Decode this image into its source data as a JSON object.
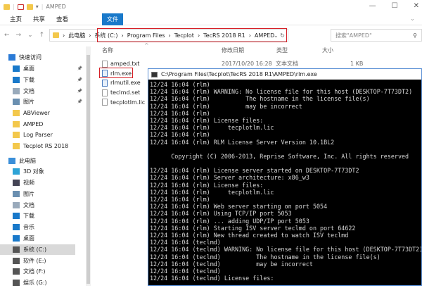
{
  "window": {
    "title": "AMPED"
  },
  "ribbon": {
    "tabs": [
      "文件",
      "主页",
      "共享",
      "查看"
    ]
  },
  "address": {
    "crumbs": [
      "此电脑",
      "系统 (C:)",
      "Program Files",
      "Tecplot",
      "TecRS 2018 R1",
      "AMPED"
    ],
    "search_placeholder": "搜索\"AMPED\""
  },
  "columns": {
    "name": "名称",
    "date": "修改日期",
    "type": "类型",
    "size": "大小"
  },
  "files": [
    {
      "name": "amped.txt",
      "date": "2017/10/20 16:28",
      "type": "文本文档",
      "size": "1 KB",
      "kind": "txt"
    },
    {
      "name": "rlm.exe",
      "kind": "exe"
    },
    {
      "name": "rlmutil.exe",
      "kind": "exe"
    },
    {
      "name": "teclmd.set",
      "kind": "txt"
    },
    {
      "name": "tecplotlm.lic",
      "kind": "txt"
    }
  ],
  "sidebar": {
    "items": [
      {
        "label": "快速访问",
        "color": "#2a7ad6",
        "indent": 0
      },
      {
        "label": "桌面",
        "color": "#1979ca",
        "pin": true
      },
      {
        "label": "下载",
        "color": "#1979ca",
        "pin": true
      },
      {
        "label": "文档",
        "color": "#9ab",
        "pin": true
      },
      {
        "label": "图片",
        "color": "#6a8fb0",
        "pin": true
      },
      {
        "label": "ABViewer",
        "color": "#f3c84c"
      },
      {
        "label": "AMPED",
        "color": "#f3c84c"
      },
      {
        "label": "Log Parser",
        "color": "#f3c84c"
      },
      {
        "label": "Tecplot RS 2018",
        "color": "#f3c84c"
      },
      {
        "label": "此电脑",
        "color": "#3b8fd9",
        "indent": 0
      },
      {
        "label": "3D 对象",
        "color": "#2ea3d6"
      },
      {
        "label": "视频",
        "color": "#445"
      },
      {
        "label": "图片",
        "color": "#6a8fb0"
      },
      {
        "label": "文档",
        "color": "#9ab"
      },
      {
        "label": "下载",
        "color": "#1979ca"
      },
      {
        "label": "音乐",
        "color": "#1979ca"
      },
      {
        "label": "桌面",
        "color": "#1979ca"
      },
      {
        "label": "系统 (C:)",
        "color": "#555",
        "selected": true
      },
      {
        "label": "软件 (E:)",
        "color": "#555"
      },
      {
        "label": "文档 (F:)",
        "color": "#555"
      },
      {
        "label": "娱乐 (G:)",
        "color": "#555"
      }
    ]
  },
  "console": {
    "title": "C:\\Program Files\\Tecplot\\TecRS 2018 R1\\AMPED\\rlm.exe",
    "lines": [
      "12/24 16:04 (rlm)",
      "12/24 16:04 (rlm) WARNING: No license file for this host (DESKTOP-7T73DT2)",
      "12/24 16:04 (rlm)          The hostname in the license file(s)",
      "12/24 16:04 (rlm)          may be incorrect",
      "12/24 16:04 (rlm)",
      "12/24 16:04 (rlm) License files:",
      "12/24 16:04 (rlm)     tecplotlm.lic",
      "12/24 16:04 (rlm)",
      "12/24 16:04 (rlm) RLM License Server Version 10.1BL2",
      "",
      "      Copyright (C) 2006-2013, Reprise Software, Inc. All rights reserved",
      "",
      "12/24 16:04 (rlm) License server started on DESKTOP-7T73DT2",
      "12/24 16:04 (rlm) Server architecture: x86_w3",
      "12/24 16:04 (rlm) License files:",
      "12/24 16:04 (rlm)     tecplotlm.lic",
      "12/24 16:04 (rlm)",
      "12/24 16:04 (rlm) Web server starting on port 5054",
      "12/24 16:04 (rlm) Using TCP/IP port 5053",
      "12/24 16:04 (rlm) ... adding UDP/IP port 5053",
      "12/24 16:04 (rlm) Starting ISV server teclmd on port 64622",
      "12/24 16:04 (rlm) New thread created to watch ISV teclmd",
      "12/24 16:04 (teclmd)",
      "12/24 16:04 (teclmd) WARNING: No license file for this host (DESKTOP-7T73DT2)",
      "12/24 16:04 (teclmd)          The hostname in the license file(s)",
      "12/24 16:04 (teclmd)          may be incorrect",
      "12/24 16:04 (teclmd)",
      "12/24 16:04 (teclmd) License files:"
    ]
  }
}
